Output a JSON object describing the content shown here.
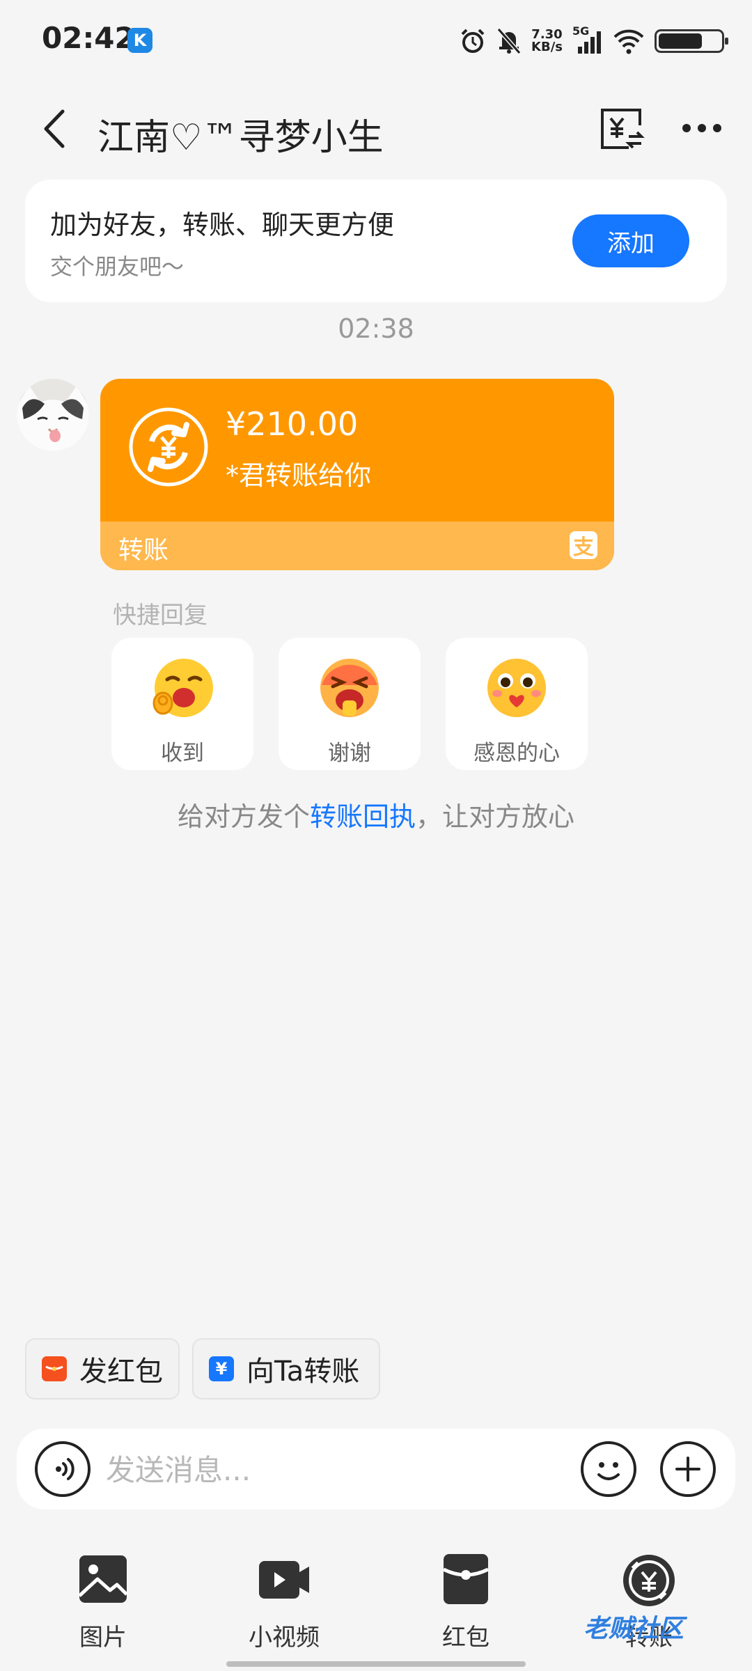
{
  "status": {
    "time": "02:42",
    "app_badge": "K",
    "net_speed_value": "7.30",
    "net_speed_unit": "KB/s",
    "signal": "5G",
    "battery_level": 0.72
  },
  "header": {
    "title": "江南♡™寻梦小生"
  },
  "friend_card": {
    "title": "加为好友，转账、聊天更方便",
    "subtitle": "交个朋友吧～",
    "add_label": "添加"
  },
  "chat": {
    "timestamp": "02:38",
    "transfer": {
      "amount": "¥210.00",
      "from": "*君转账给你",
      "label": "转账",
      "provider_icon": "支"
    },
    "quick_reply": {
      "heading": "快捷回复",
      "options": [
        {
          "label": "收到"
        },
        {
          "label": "谢谢"
        },
        {
          "label": "感恩的心"
        }
      ]
    },
    "receipt_tip": {
      "before": "给对方发个",
      "link": "转账回执",
      "after": "，让对方放心"
    }
  },
  "shortcuts": [
    {
      "label": "发红包",
      "icon": "red-packet-icon"
    },
    {
      "label": "向Ta转账",
      "icon": "transfer-icon"
    }
  ],
  "input": {
    "placeholder": "发送消息..."
  },
  "toolbar": [
    {
      "label": "图片",
      "icon": "image-icon"
    },
    {
      "label": "小视频",
      "icon": "video-icon"
    },
    {
      "label": "红包",
      "icon": "red-packet-icon"
    },
    {
      "label": "转账",
      "icon": "transfer-icon"
    }
  ],
  "watermark": "老贼社区",
  "colors": {
    "accent": "#1677ff",
    "transfer_bg": "#ff9800",
    "transfer_footer": "#ffb84d",
    "background": "#f5f5f5"
  }
}
